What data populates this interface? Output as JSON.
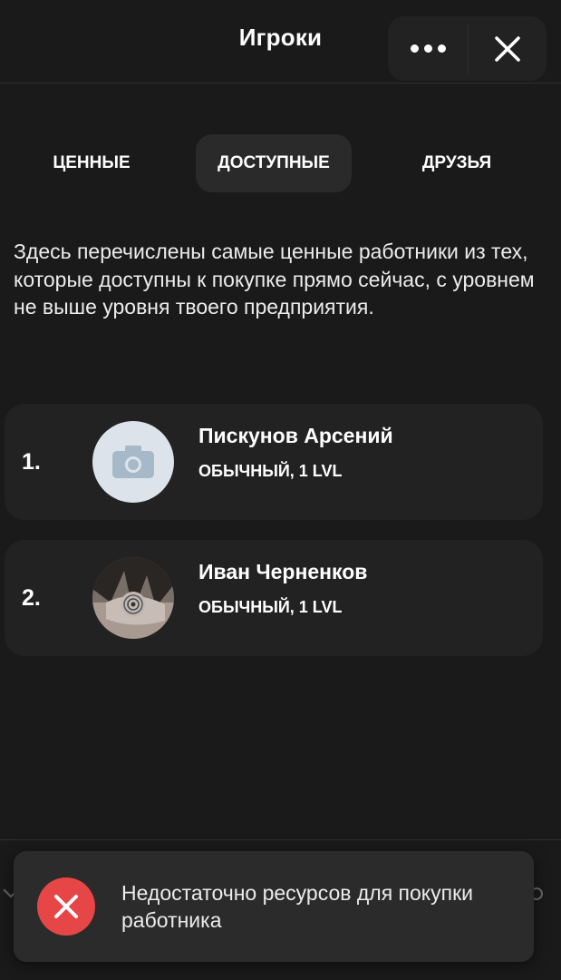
{
  "header": {
    "title": "Игроки",
    "more_icon": "more-horizontal-icon",
    "close_icon": "close-icon"
  },
  "tabs": [
    {
      "label": "ЦЕННЫЕ",
      "active": false
    },
    {
      "label": "ДОСТУПНЫЕ",
      "active": true
    },
    {
      "label": "ДРУЗЬЯ",
      "active": false
    }
  ],
  "description": "Здесь перечислены самые ценные работники из тех, которые доступны к покупке прямо сейчас, с уровнем не выше уровня твоего предприятия.",
  "players": [
    {
      "rank": "1.",
      "name": "Пискунов Арсений",
      "level": "ОБЫЧНЫЙ, 1 LVL",
      "avatar": "camera-placeholder-icon"
    },
    {
      "rank": "2.",
      "name": "Иван Черненков",
      "level": "ОБЫЧНЫЙ, 1 LVL",
      "avatar": "user-photo"
    }
  ],
  "toast": {
    "message": "Недостаточно ресурсов для покупки работника",
    "icon": "error-x-icon",
    "icon_color": "#e64646"
  },
  "colors": {
    "background": "#1a1a1a",
    "card": "#222222",
    "active_tab": "#2a2a2a"
  }
}
